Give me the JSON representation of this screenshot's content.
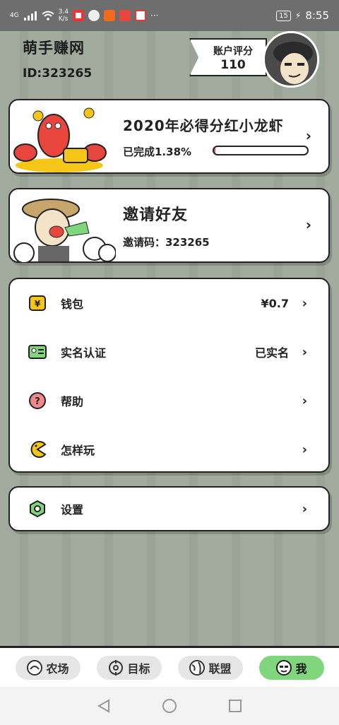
{
  "status_bar": {
    "network": "4G",
    "speed": "3.4\nK/s",
    "battery": "15",
    "time": "8:55"
  },
  "header": {
    "app_title": "萌手赚网",
    "user_id": "ID:323265",
    "score_label": "账户评分",
    "score_value": "110"
  },
  "cards": {
    "lobster": {
      "title": "2020年必得分红小龙虾",
      "progress_text": "已完成1.38%",
      "progress_value": 0.0138
    },
    "invite": {
      "title": "邀请好友",
      "code_text": "邀请码：323265"
    }
  },
  "menu": {
    "wallet": {
      "label": "钱包",
      "value": "¥0.7"
    },
    "verify": {
      "label": "实名认证",
      "value": "已实名"
    },
    "help": {
      "label": "帮助"
    },
    "howto": {
      "label": "怎样玩"
    },
    "settings": {
      "label": "设置"
    }
  },
  "bottom_nav": {
    "tabs": [
      {
        "label": "农场",
        "icon": "farm-icon"
      },
      {
        "label": "目标",
        "icon": "target-icon"
      },
      {
        "label": "联盟",
        "icon": "globe-icon"
      },
      {
        "label": "我",
        "icon": "face-icon"
      }
    ],
    "active": "我"
  },
  "colors": {
    "background": "#a3ab9f",
    "active_tab": "#7fd67c",
    "progress": "#e8453c"
  }
}
